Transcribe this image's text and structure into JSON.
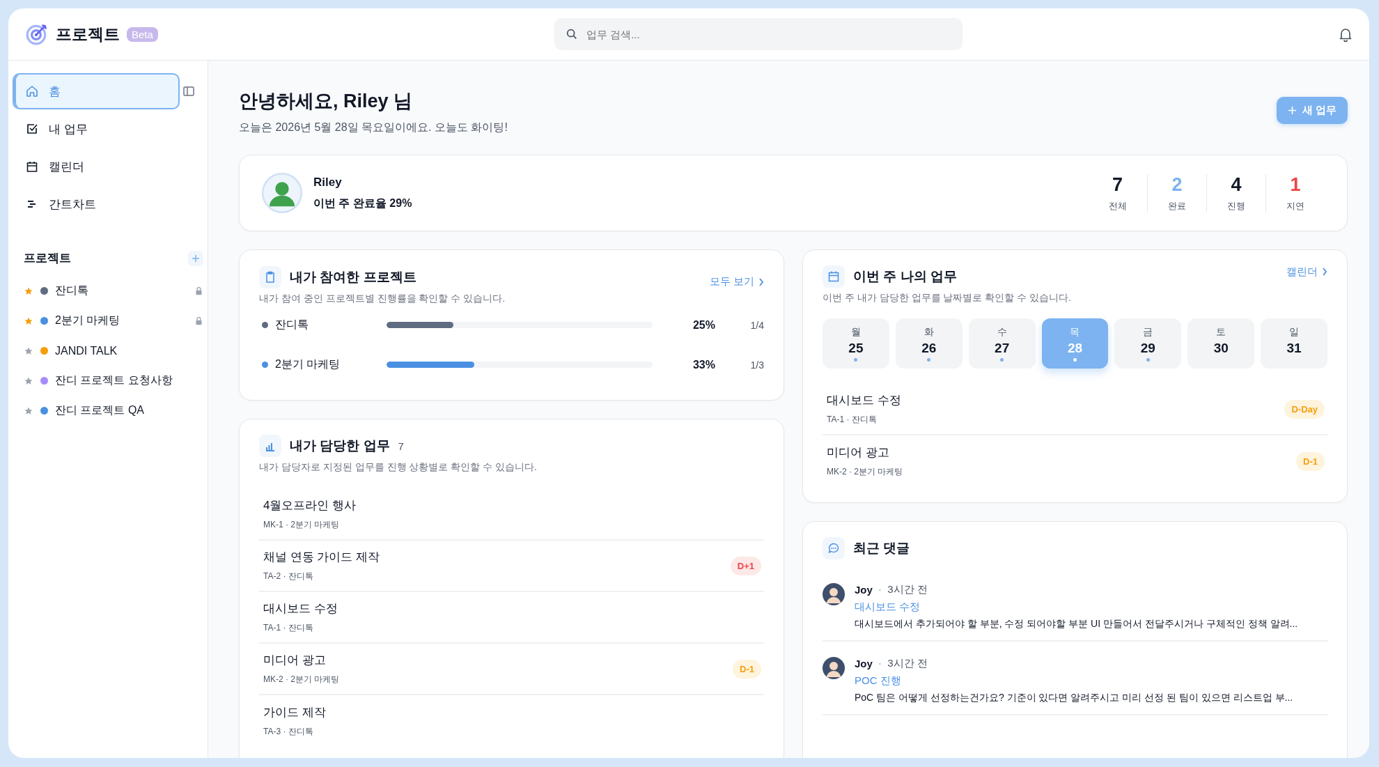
{
  "header": {
    "brand": "프로젝트",
    "badge": "Beta",
    "search": {
      "placeholder": "업무 검색..."
    }
  },
  "sidebar": {
    "nav": [
      {
        "label": "홈",
        "selected": true
      },
      {
        "label": "내 업무",
        "selected": false
      },
      {
        "label": "캘린더",
        "selected": false
      },
      {
        "label": "간트차트",
        "selected": false
      }
    ],
    "projects_title": "프로젝트",
    "projects": [
      {
        "name": "잔디톡",
        "starred": true,
        "color": "#5f6b80",
        "locked": true
      },
      {
        "name": "2분기 마케팅",
        "starred": true,
        "color": "#4a90e2",
        "locked": true
      },
      {
        "name": "JANDI TALK",
        "starred": false,
        "color": "#f59e0b",
        "locked": false
      },
      {
        "name": "잔디 프로젝트 요청사항",
        "starred": false,
        "color": "#a78bfa",
        "locked": false
      },
      {
        "name": "잔디 프로젝트 QA",
        "starred": false,
        "color": "#4a90e2",
        "locked": false
      }
    ]
  },
  "greeting": {
    "title": "안녕하세요, **Riley** 님",
    "subtitle": "오늘은 2026년 5월 28일 목요일이에요. 오늘도 화이팅!",
    "new_button": "새 업무"
  },
  "profile": {
    "name": "Riley",
    "completion": "이번 주 완료율 29%",
    "stats": [
      {
        "value": "7",
        "label": "전체",
        "color": "#111827"
      },
      {
        "value": "2",
        "label": "완료",
        "color": "#7cb3f0"
      },
      {
        "value": "4",
        "label": "진행",
        "color": "#111827"
      },
      {
        "value": "1",
        "label": "지연",
        "color": "#ef4444"
      }
    ]
  },
  "my_projects": {
    "title": "내가 참여한 프로젝트",
    "description": "내가 참여 중인 프로젝트별 진행률을 확인할 수 있습니다.",
    "link": "모두 보기",
    "rows": [
      {
        "name": "잔디톡",
        "color": "#5f6b80",
        "level": 0.25,
        "percent": "25%",
        "count": "1/4"
      },
      {
        "name": "2분기 마케팅",
        "color": "#4a90e2",
        "level": 0.33,
        "percent": "33%",
        "count": "1/3"
      }
    ]
  },
  "my_tasks": {
    "title": "내가 담당한 업무",
    "count": "7",
    "description": "내가 담당자로 지정된 업무를 진행 상황별로 확인할 수 있습니다.",
    "tasks": [
      {
        "title": "4월오프라인 행사",
        "meta": "MK-1 · 2분기 마케팅"
      },
      {
        "title": "채널 연동 가이드 제작",
        "meta": "TA-2 · 잔디톡",
        "due": "D+1",
        "kind": "overdue"
      },
      {
        "title": "대시보드 수정",
        "meta": "TA-1 · 잔디톡"
      },
      {
        "title": "미디어 광고",
        "meta": "MK-2 · 2분기 마케팅",
        "due": "D-1",
        "kind": "soon"
      },
      {
        "title": "가이드 제작",
        "meta": "TA-3 · 잔디톡"
      }
    ]
  },
  "this_week": {
    "title": "이번 주 나의 업무",
    "link": "캘린더",
    "description": "이번 주 내가 담당한 업무를 날짜별로 확인할 수 있습니다.",
    "days": [
      {
        "weekday": "월",
        "date": "25",
        "selected": false,
        "has_task": true
      },
      {
        "weekday": "화",
        "date": "26",
        "selected": false,
        "has_task": true
      },
      {
        "weekday": "수",
        "date": "27",
        "selected": false,
        "has_task": true
      },
      {
        "weekday": "목",
        "date": "28",
        "selected": true,
        "has_task": true
      },
      {
        "weekday": "금",
        "date": "29",
        "selected": false,
        "has_task": true
      },
      {
        "weekday": "토",
        "date": "30",
        "selected": false,
        "has_task": false
      },
      {
        "weekday": "일",
        "date": "31",
        "selected": false,
        "has_task": false
      }
    ],
    "tasks": [
      {
        "title": "대시보드 수정",
        "meta": "TA-1 · 잔디톡",
        "due": "D-Day",
        "kind": "soon"
      },
      {
        "title": "미디어 광고",
        "meta": "MK-2 · 2분기 마케팅",
        "due": "D-1",
        "kind": "soon"
      }
    ]
  },
  "recent_comments": {
    "title": "최근 댓글",
    "comments": [
      {
        "author": "Joy",
        "separator": "·",
        "time": "3시간 전",
        "task": "대시보드 수정",
        "text": "대시보드에서 추가되어야 할 부분, 수정 되어야할 부분 UI 만들어서 전달주시거나 구체적인 정책 알려..."
      },
      {
        "author": "Joy",
        "separator": "·",
        "time": "3시간 전",
        "task": "POC 진행",
        "text": "PoC 팀은 어떻게 선정하는건가요? 기준이 있다면 알려주시고 미리 선정 된 팀이 있으면 리스트업 부..."
      }
    ]
  }
}
